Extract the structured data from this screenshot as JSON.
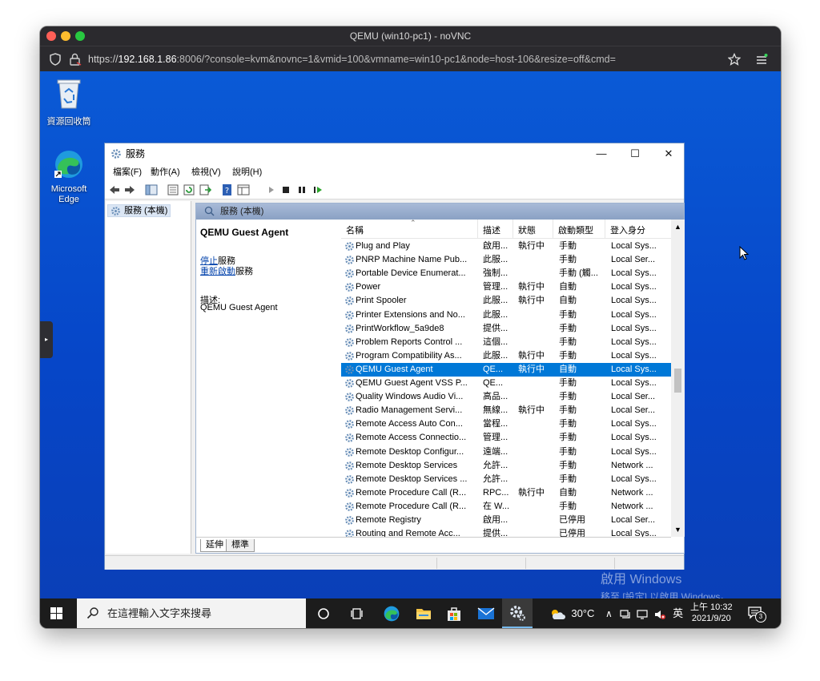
{
  "browser": {
    "title": "QEMU (win10-pc1) - noVNC",
    "url_prefix": "https://",
    "url_host": "192.168.1.86",
    "url_rest": ":8006/?console=kvm&novnc=1&vmid=100&vmname=win10-pc1&node=host-106&resize=off&cmd="
  },
  "desktop": {
    "icons": [
      {
        "label": "資源回收筒",
        "icon": "recycle-bin-icon"
      },
      {
        "label": "Microsoft Edge",
        "icon": "edge-icon"
      }
    ],
    "activate_title": "啟用 Windows",
    "activate_sub": "移至 [設定] 以啟用 Windows。"
  },
  "services": {
    "title": "服務",
    "menu": [
      "檔案(F)",
      "動作(A)",
      "檢視(V)",
      "說明(H)"
    ],
    "tree_node": "服務 (本機)",
    "pane_header": "服務 (本機)",
    "selected_name": "QEMU Guest Agent",
    "action_stop_link": "停止",
    "action_stop_rest": "服務",
    "action_restart_link": "重新啟動",
    "action_restart_rest": "服務",
    "desc_label": "描述:",
    "desc_value": "QEMU Guest Agent",
    "columns": [
      "名稱",
      "描述",
      "狀態",
      "啟動類型",
      "登入身分"
    ],
    "rows": [
      {
        "name": "Plug and Play",
        "desc": "啟用...",
        "status": "執行中",
        "startup": "手動",
        "logon": "Local Sys..."
      },
      {
        "name": "PNRP Machine Name Pub...",
        "desc": "此服...",
        "status": "",
        "startup": "手動",
        "logon": "Local Ser..."
      },
      {
        "name": "Portable Device Enumerat...",
        "desc": "強制...",
        "status": "",
        "startup": "手動 (觸...",
        "logon": "Local Sys..."
      },
      {
        "name": "Power",
        "desc": "管理...",
        "status": "執行中",
        "startup": "自動",
        "logon": "Local Sys..."
      },
      {
        "name": "Print Spooler",
        "desc": "此服...",
        "status": "執行中",
        "startup": "自動",
        "logon": "Local Sys..."
      },
      {
        "name": "Printer Extensions and No...",
        "desc": "此服...",
        "status": "",
        "startup": "手動",
        "logon": "Local Sys..."
      },
      {
        "name": "PrintWorkflow_5a9de8",
        "desc": "提供...",
        "status": "",
        "startup": "手動",
        "logon": "Local Sys..."
      },
      {
        "name": "Problem Reports Control ...",
        "desc": "這個...",
        "status": "",
        "startup": "手動",
        "logon": "Local Sys..."
      },
      {
        "name": "Program Compatibility As...",
        "desc": "此服...",
        "status": "執行中",
        "startup": "手動",
        "logon": "Local Sys..."
      },
      {
        "name": "QEMU Guest Agent",
        "desc": "QE...",
        "status": "執行中",
        "startup": "自動",
        "logon": "Local Sys...",
        "selected": true
      },
      {
        "name": "QEMU Guest Agent VSS P...",
        "desc": "QE...",
        "status": "",
        "startup": "手動",
        "logon": "Local Sys..."
      },
      {
        "name": "Quality Windows Audio Vi...",
        "desc": "高品...",
        "status": "",
        "startup": "手動",
        "logon": "Local Ser..."
      },
      {
        "name": "Radio Management Servi...",
        "desc": "無線...",
        "status": "執行中",
        "startup": "手動",
        "logon": "Local Ser..."
      },
      {
        "name": "Remote Access Auto Con...",
        "desc": "當程...",
        "status": "",
        "startup": "手動",
        "logon": "Local Sys..."
      },
      {
        "name": "Remote Access Connectio...",
        "desc": "管理...",
        "status": "",
        "startup": "手動",
        "logon": "Local Sys..."
      },
      {
        "name": "Remote Desktop Configur...",
        "desc": "遠端...",
        "status": "",
        "startup": "手動",
        "logon": "Local Sys..."
      },
      {
        "name": "Remote Desktop Services",
        "desc": "允許...",
        "status": "",
        "startup": "手動",
        "logon": "Network ..."
      },
      {
        "name": "Remote Desktop Services ...",
        "desc": "允許...",
        "status": "",
        "startup": "手動",
        "logon": "Local Sys..."
      },
      {
        "name": "Remote Procedure Call (R...",
        "desc": "RPC...",
        "status": "執行中",
        "startup": "自動",
        "logon": "Network ..."
      },
      {
        "name": "Remote Procedure Call (R...",
        "desc": "在 W...",
        "status": "",
        "startup": "手動",
        "logon": "Network ..."
      },
      {
        "name": "Remote Registry",
        "desc": "啟用...",
        "status": "",
        "startup": "已停用",
        "logon": "Local Ser..."
      },
      {
        "name": "Routing and Remote Acc...",
        "desc": "提供...",
        "status": "",
        "startup": "已停用",
        "logon": "Local Sys..."
      }
    ],
    "tabs": [
      "延伸",
      "標準"
    ]
  },
  "taskbar": {
    "search_placeholder": "在這裡輸入文字來搜尋",
    "weather": "30°C",
    "ime": "英",
    "time": "上午 10:32",
    "date": "2021/9/20",
    "notification_count": "3"
  },
  "colors": {
    "desktop": "#0a4fd0",
    "selection": "#0078d7",
    "taskbar": "#1c1c1c"
  }
}
